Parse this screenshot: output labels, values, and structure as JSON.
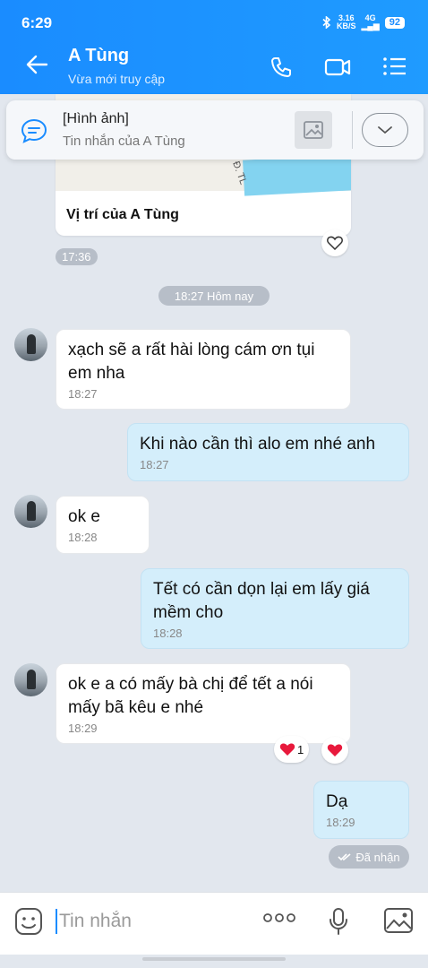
{
  "status_bar": {
    "time": "6:29",
    "net_speed_top": "3.16",
    "net_speed_bottom": "KB/S",
    "network": "4G",
    "battery": "92"
  },
  "header": {
    "title": "A Tùng",
    "subtitle": "Vừa mới truy cập",
    "accent_color": "#1a8cff"
  },
  "pinned": {
    "title": "[Hình ảnh]",
    "subtitle": "Tin nhắn của A Tùng"
  },
  "map_card": {
    "road_label": "Đ. TL",
    "caption": "Vị trí của A Tùng",
    "time": "17:36"
  },
  "day_divider": "18:27 Hôm nay",
  "messages": [
    {
      "side": "in",
      "line1": "xạch sẽ a rất hài lòng cám ơn tụi",
      "line2": "em nha",
      "time": "18:27"
    },
    {
      "side": "out",
      "text": "Khi nào cần thì alo em nhé anh",
      "time": "18:27"
    },
    {
      "side": "in",
      "text": "ok e",
      "time": "18:28"
    },
    {
      "side": "out",
      "line1": "Tết có cần dọn lại em lấy giá",
      "line2": "mềm cho",
      "time": "18:28"
    },
    {
      "side": "in",
      "line1": "ok e a có mấy bà chị để tết a nói",
      "line2": "mấy bã kêu e nhé",
      "time": "18:29",
      "reaction_count": "1"
    },
    {
      "side": "out",
      "text": "Dạ",
      "time": "18:29"
    }
  ],
  "seen_label": "Đã nhận",
  "composer": {
    "placeholder": "Tin nhắn"
  }
}
